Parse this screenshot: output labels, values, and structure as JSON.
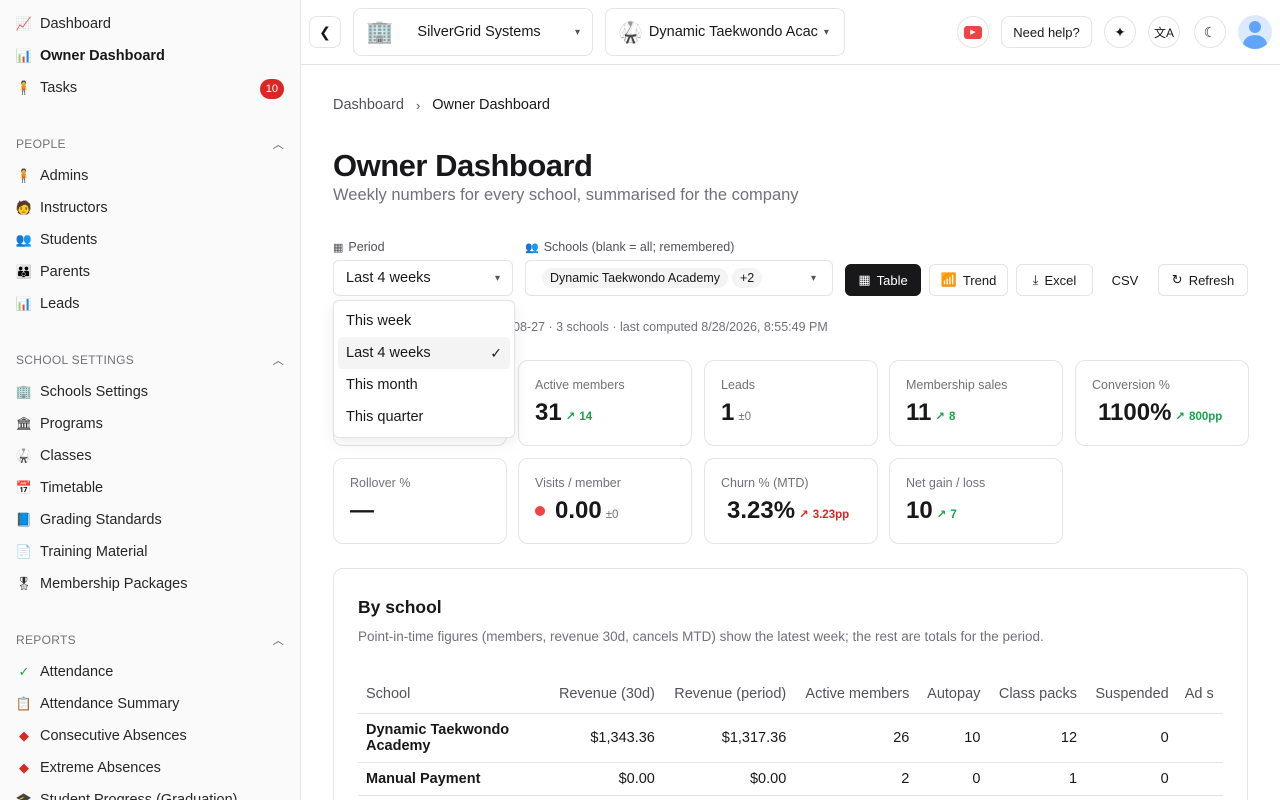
{
  "sidebar": {
    "top": [
      {
        "label": "Dashboard",
        "icon": "chart-icon"
      },
      {
        "label": "Owner Dashboard",
        "icon": "chart-up-icon"
      },
      {
        "label": "Tasks",
        "icon": "person-icon",
        "badge": "10"
      }
    ],
    "people": {
      "title": "PEOPLE",
      "items": [
        "Admins",
        "Instructors",
        "Students",
        "Parents",
        "Leads"
      ]
    },
    "school_settings": {
      "title": "SCHOOL SETTINGS",
      "items": [
        "Schools Settings",
        "Programs",
        "Classes",
        "Timetable",
        "Grading Standards",
        "Training Material",
        "Membership Packages"
      ]
    },
    "reports": {
      "title": "REPORTS",
      "items": [
        "Attendance",
        "Attendance Summary",
        "Consecutive Absences",
        "Extreme Absences",
        "Student Progress (Graduation)"
      ]
    }
  },
  "topbar": {
    "company": "SilverGrid Systems",
    "school": "Dynamic Taekwondo Acac",
    "help": "Need help?"
  },
  "breadcrumb": {
    "root": "Dashboard",
    "current": "Owner Dashboard"
  },
  "page": {
    "title": "Owner Dashboard",
    "subtitle": "Weekly numbers for every school, summarised for the company"
  },
  "filters": {
    "period_label": "Period",
    "period_value": "Last 4 weeks",
    "schools_label": "Schools (blank = all; remembered)",
    "schools_chip": "Dynamic Taekwondo Academy",
    "schools_more": "+2",
    "buttons": {
      "table": "Table",
      "trend": "Trend",
      "excel": "Excel",
      "csv": "CSV",
      "refresh": "Refresh"
    }
  },
  "meta_line": "08-27 · 3 schools · last computed 8/28/2026, 8:55:49 PM",
  "period_options": [
    "This week",
    "Last 4 weeks",
    "This month",
    "This quarter"
  ],
  "cards": [
    {
      "label": "Active members",
      "value": "31",
      "delta": "14",
      "tone": "up"
    },
    {
      "label": "Leads",
      "value": "1",
      "delta": "±0",
      "tone": "neutral"
    },
    {
      "label": "Membership sales",
      "value": "11",
      "delta": "8",
      "tone": "up"
    },
    {
      "label": "Conversion %",
      "value": "1100%",
      "delta": "800pp",
      "tone": "up"
    },
    {
      "label": "Rollover %",
      "value": "—",
      "delta": "",
      "tone": "neutral"
    },
    {
      "label": "Visits / member",
      "value": "0.00",
      "delta": "±0",
      "tone": "neutral"
    },
    {
      "label": "Churn % (MTD)",
      "value": "3.23%",
      "delta": "3.23pp",
      "tone": "bad"
    },
    {
      "label": "Net gain / loss",
      "value": "10",
      "delta": "7",
      "tone": "up"
    }
  ],
  "by_school": {
    "title": "By school",
    "description": "Point-in-time figures (members, revenue 30d, cancels MTD) show the latest week; the rest are totals for the period.",
    "columns": [
      "School",
      "Revenue (30d)",
      "Revenue (period)",
      "Active members",
      "Autopay",
      "Class packs",
      "Suspended",
      "Ad s"
    ],
    "rows": [
      [
        "Dynamic Taekwondo Academy",
        "$1,343.36",
        "$1,317.36",
        "26",
        "10",
        "12",
        "0",
        ""
      ],
      [
        "Manual Payment",
        "$0.00",
        "$0.00",
        "2",
        "0",
        "1",
        "0",
        ""
      ]
    ]
  }
}
